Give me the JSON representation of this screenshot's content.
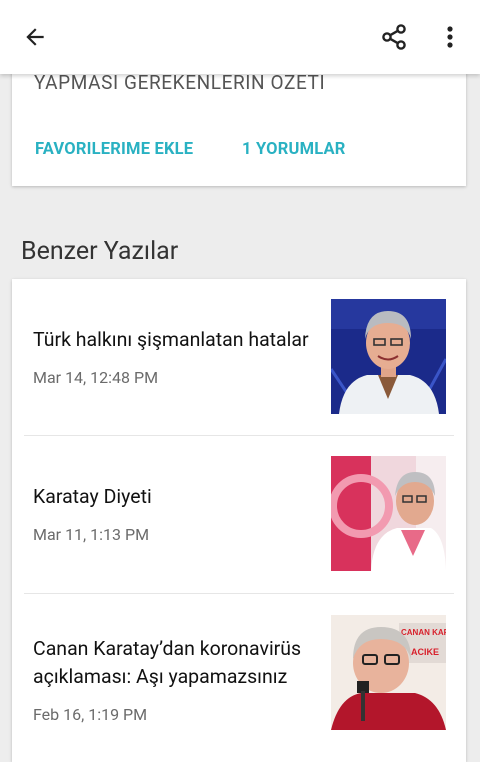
{
  "appbar": {
    "back_icon": "arrow-left-icon",
    "share_icon": "share-icon",
    "more_icon": "more-vertical-icon"
  },
  "article": {
    "summary_text": "YAPMASI GEREKENLERIN OZETI",
    "favorite_label": "FAVORILERIME EKLE",
    "comments_label": "1  YORUMLAR",
    "accent_color": "#29b1c2"
  },
  "related": {
    "title": "Benzer Yazılar",
    "posts": [
      {
        "title": "Türk halkını şişmanlatan hatalar",
        "date": "Mar 14, 12:48 PM"
      },
      {
        "title": "Karatay Diyeti",
        "date": "Mar 11, 1:13 PM"
      },
      {
        "title": "Canan Karatay’dan koronavirüs açıklaması: Aşı yapamazsınız",
        "date": "Feb 16, 1:19 PM"
      }
    ]
  },
  "thumb3": {
    "banner_line1": "CANAN KARA",
    "banner_line2": "ACIKE"
  }
}
